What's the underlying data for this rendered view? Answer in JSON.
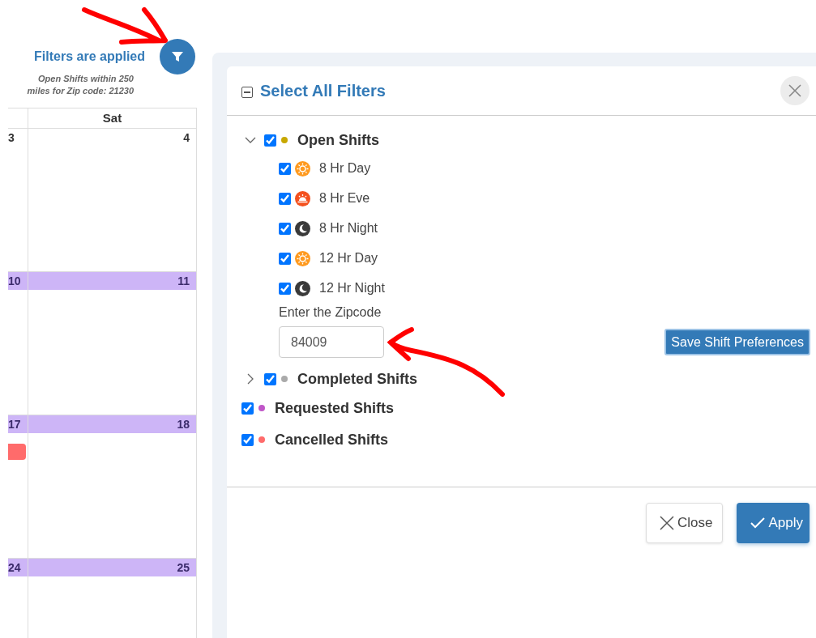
{
  "status": {
    "title": "Filters are applied",
    "note": "Open Shifts within 250 miles for Zip code: 21230"
  },
  "calendar": {
    "columns": [
      "",
      "Sat"
    ],
    "weeks": [
      {
        "days": [
          "3",
          "4"
        ],
        "highlighted": false
      },
      {
        "days": [
          "10",
          "11"
        ],
        "highlighted": true
      },
      {
        "days": [
          "17",
          "18"
        ],
        "highlighted": true,
        "event": {
          "color": "#ff6b6b"
        }
      },
      {
        "days": [
          "24",
          "25"
        ],
        "highlighted": true
      }
    ]
  },
  "dialog": {
    "title": "Select All Filters",
    "select_all_partial": true,
    "filters": [
      {
        "kind": "group",
        "label": "Open Shifts",
        "checked": true,
        "color": "#c8a800",
        "expanded": true,
        "children": [
          {
            "kind": "day",
            "label": "8 Hr Day",
            "checked": true
          },
          {
            "kind": "evening",
            "label": "8 Hr Eve",
            "checked": true
          },
          {
            "kind": "night",
            "label": "8 Hr Night",
            "checked": true
          },
          {
            "kind": "day",
            "label": "12 Hr Day",
            "checked": true
          },
          {
            "kind": "night",
            "label": "12 Hr Night",
            "checked": true
          }
        ],
        "zipcode": {
          "label": "Enter the Zipcode",
          "value": "84009"
        },
        "save_button": "Save Shift Preferences"
      },
      {
        "kind": "group",
        "label": "Completed Shifts",
        "checked": true,
        "color": "#aaaaaa",
        "expanded": false
      },
      {
        "kind": "item",
        "label": "Requested Shifts",
        "checked": true,
        "color": "#c056c8"
      },
      {
        "kind": "item",
        "label": "Cancelled Shifts",
        "checked": true,
        "color": "#ff6b6b"
      }
    ],
    "buttons": [
      {
        "kind": "close",
        "label": "Close"
      },
      {
        "kind": "apply",
        "label": "Apply"
      }
    ]
  }
}
